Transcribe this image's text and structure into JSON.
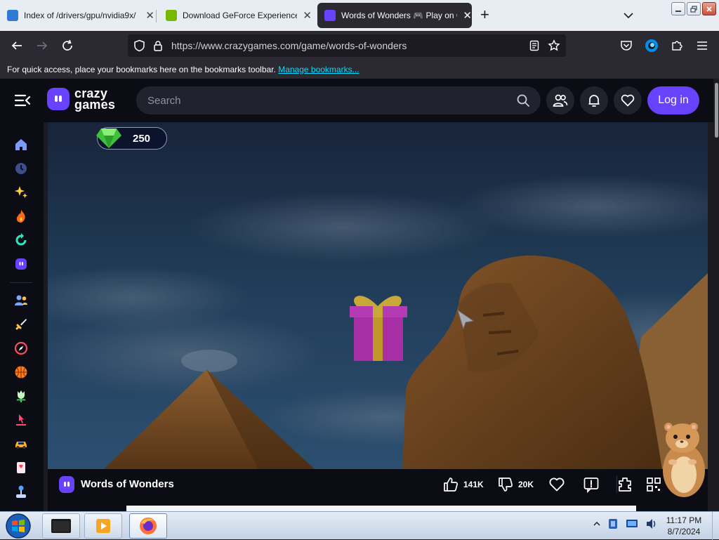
{
  "browser": {
    "tabs": [
      {
        "label": "Index of /drivers/gpu/nvidia9x/",
        "active": false
      },
      {
        "label": "Download GeForce Experience",
        "active": false
      },
      {
        "label": "Words of Wonders 🎮 Play on C",
        "active": true
      }
    ],
    "url": "https://www.crazygames.com/game/words-of-wonders",
    "bookmarks_hint": "For quick access, place your bookmarks here on the bookmarks toolbar.",
    "bookmarks_link": "Manage bookmarks..."
  },
  "site": {
    "logo_line1": "crazy",
    "logo_line2": "games",
    "search_placeholder": "Search",
    "login_label": "Log in",
    "brand_color": "#6842ff"
  },
  "sidebar": {
    "icons": [
      "home-icon",
      "recent-icon",
      "new-icon",
      "trending-icon",
      "updated-icon",
      "originals-icon",
      "multiplayer-icon",
      "action-icon",
      "adventure-icon",
      "basketball-icon",
      "casual-icon",
      "clicker-icon",
      "driving-icon",
      "card-icon",
      "controller-icon"
    ]
  },
  "game": {
    "gems": "250",
    "title": "Words of Wonders",
    "likes": "141K",
    "dislikes": "20K"
  },
  "taskbar": {
    "time": "11:17 PM",
    "date": "8/7/2024"
  }
}
